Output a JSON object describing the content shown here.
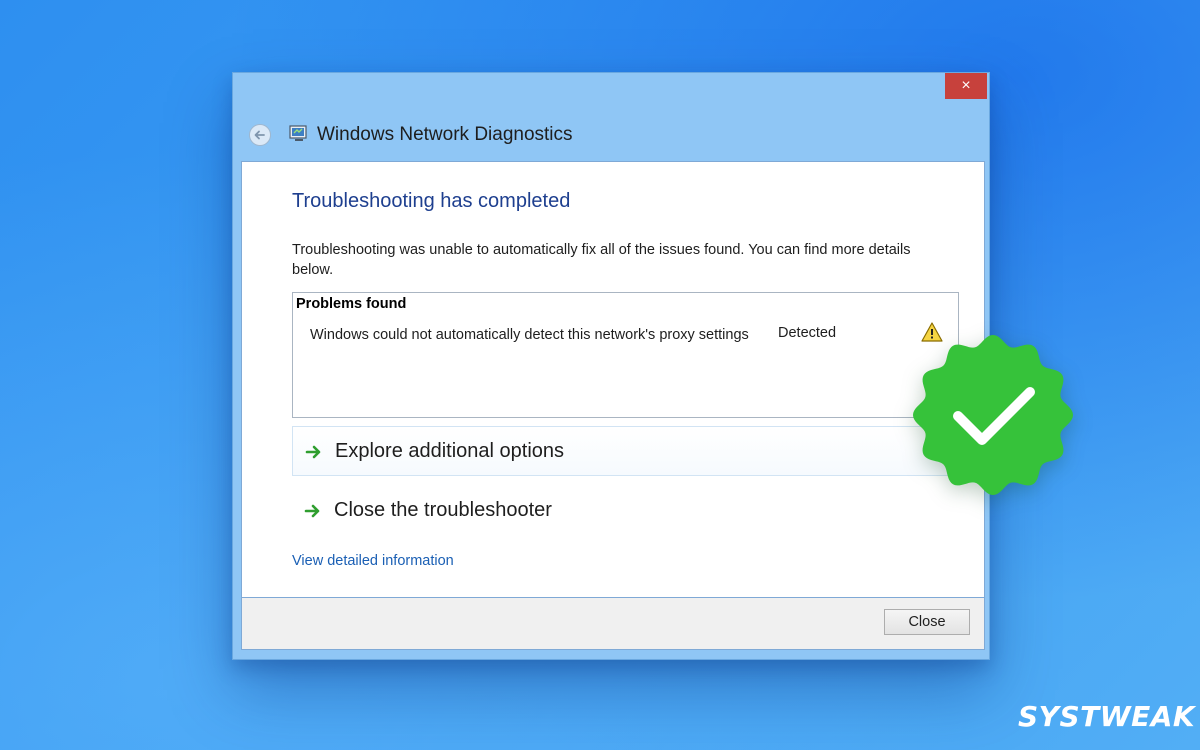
{
  "window": {
    "title": "Windows Network Diagnostics",
    "close_glyph": "×"
  },
  "content": {
    "heading": "Troubleshooting has completed",
    "description": "Troubleshooting was unable to automatically fix all of the issues found. You can find more details below.",
    "problems": {
      "header": "Problems found",
      "items": [
        {
          "text": "Windows could not automatically detect this network's proxy settings",
          "status": "Detected",
          "icon": "warning-icon"
        }
      ]
    },
    "options": [
      {
        "label": "Explore additional options",
        "icon": "green-arrow-icon"
      },
      {
        "label": "Close the troubleshooter",
        "icon": "green-arrow-icon"
      }
    ],
    "detail_link": "View detailed information"
  },
  "footer": {
    "close_label": "Close"
  },
  "overlay": {
    "badge_icon": "check-badge-icon",
    "brand": "SYSTWEAK"
  },
  "colors": {
    "background": "#3a9cf3",
    "heading": "#1e3f8f",
    "link": "#1a5fb4",
    "close_button": "#c7413c",
    "badge": "#36c23a",
    "arrow": "#2f9e2f"
  }
}
